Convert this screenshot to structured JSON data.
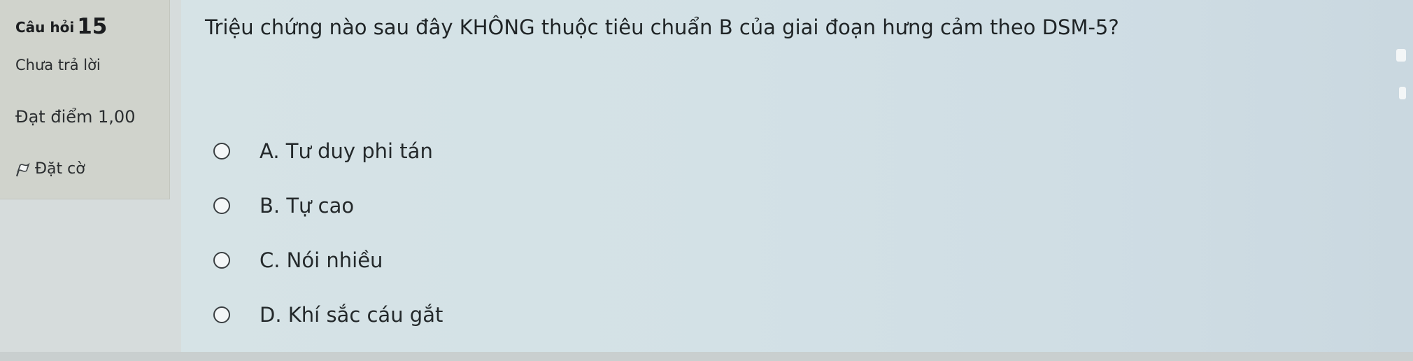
{
  "sidebar": {
    "question_prefix": "Câu hỏi",
    "question_number": "15",
    "status": "Chưa trả lời",
    "score": "Đạt điểm 1,00",
    "flag_label": "Đặt cờ"
  },
  "question": {
    "text": "Triệu chứng nào sau đây KHÔNG thuộc tiêu chuẩn B của giai đoạn hưng cảm theo DSM-5?",
    "options": [
      {
        "label": "A. Tư duy phi tán"
      },
      {
        "label": "B. Tự cao"
      },
      {
        "label": "C. Nói nhiều"
      },
      {
        "label": "D. Khí sắc cáu gắt"
      }
    ]
  }
}
